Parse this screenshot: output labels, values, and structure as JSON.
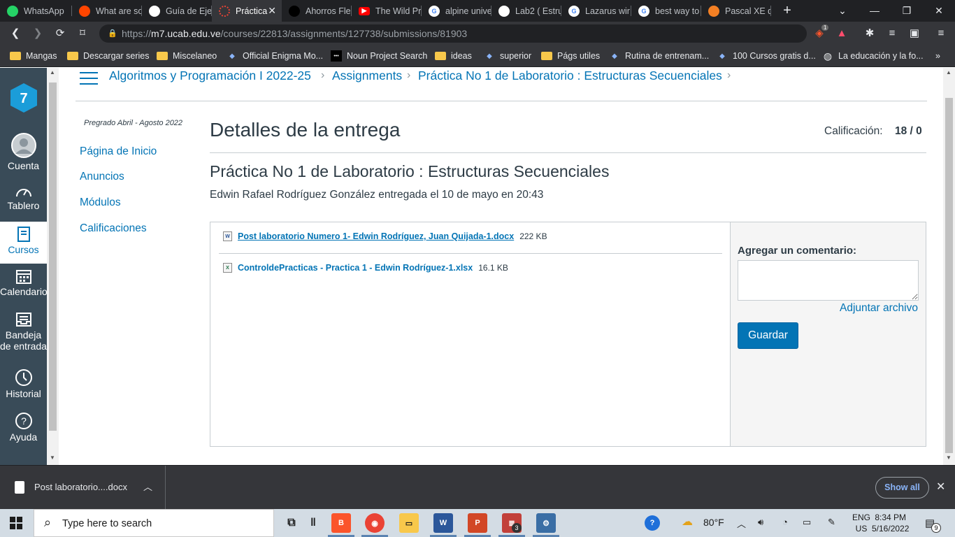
{
  "browser": {
    "tabs": [
      {
        "label": "WhatsApp",
        "icon": "whatsapp-icon",
        "color": "#25d366",
        "active": false
      },
      {
        "label": "What are so",
        "icon": "reddit-icon",
        "color": "#ff4500",
        "active": false
      },
      {
        "label": "Guía de Ejer",
        "icon": "globe-icon",
        "color": "#ffffff",
        "active": false
      },
      {
        "label": "Práctica",
        "icon": "loading-icon",
        "color": "#ea4335",
        "active": true
      },
      {
        "label": "Ahorros Flex",
        "icon": "site-icon",
        "color": "#000000",
        "active": false
      },
      {
        "label": "The Wild Pr",
        "icon": "youtube-icon",
        "color": "#ff0000",
        "active": false
      },
      {
        "label": "alpine unive",
        "icon": "google-icon",
        "color": "#ffffff",
        "active": false
      },
      {
        "label": "Lab2 ( Estru",
        "icon": "globe-icon",
        "color": "#ffffff",
        "active": false
      },
      {
        "label": "Lazarus wir",
        "icon": "google-icon",
        "color": "#ffffff",
        "active": false
      },
      {
        "label": "best way to",
        "icon": "google-icon",
        "color": "#ffffff",
        "active": false
      },
      {
        "label": "Pascal XE de",
        "icon": "site-icon",
        "color": "#f48024",
        "active": false
      }
    ],
    "url_prefix": "https://",
    "url_host": "m7.ucab.edu.ve",
    "url_path": "/courses/22813/assignments/127738/submissions/81903",
    "brave_badge": "1",
    "bookmarks": [
      {
        "label": "Mangas",
        "icon": "folder-icon"
      },
      {
        "label": "Descargar series",
        "icon": "folder-icon"
      },
      {
        "label": "Miscelaneo",
        "icon": "folder-icon"
      },
      {
        "label": "Official Enigma Mo...",
        "icon": "site-icon"
      },
      {
        "label": "Noun Project Search",
        "icon": "noun-project-icon"
      },
      {
        "label": "ideas",
        "icon": "folder-icon"
      },
      {
        "label": "superior",
        "icon": "site-icon"
      },
      {
        "label": "Págs utiles",
        "icon": "folder-icon"
      },
      {
        "label": "Rutina de entrenam...",
        "icon": "site-icon"
      },
      {
        "label": "100 Cursos gratis d...",
        "icon": "site-icon"
      },
      {
        "label": "La educación y la fo...",
        "icon": "globe-icon"
      }
    ]
  },
  "global_nav": {
    "logo": "m7-logo",
    "items": [
      {
        "label": "Cuenta",
        "icon": "account-icon"
      },
      {
        "label": "Tablero",
        "icon": "dashboard-icon"
      },
      {
        "label": "Cursos",
        "icon": "courses-icon"
      },
      {
        "label": "Calendario",
        "icon": "calendar-icon"
      },
      {
        "label": "Bandeja",
        "label2": "de entrada",
        "icon": "inbox-icon"
      },
      {
        "label": "Historial",
        "icon": "history-icon"
      },
      {
        "label": "Ayuda",
        "icon": "help-icon"
      }
    ]
  },
  "breadcrumb": {
    "course": "Algoritmos y Programación I 2022-25",
    "section": "Assignments",
    "assignment": "Práctica No 1 de Laboratorio : Estructuras Secuenciales"
  },
  "course_nav": {
    "term": "Pregrado Abril - Agosto 2022",
    "items": [
      "Página de Inicio",
      "Anuncios",
      "Módulos",
      "Calificaciones"
    ]
  },
  "submission": {
    "page_title": "Detalles de la entrega",
    "grade_label": "Calificación:",
    "grade_value": "18 / 0",
    "assignment_title": "Práctica No 1 de Laboratorio : Estructuras Secuenciales",
    "submitted_line": "Edwin Rafael Rodríguez González entregada el 10 de mayo en 20:43",
    "files": [
      {
        "name": "Post laboratorio Numero 1- Edwin Rodríguez, Juan Quijada-1.docx",
        "size": "222 KB",
        "icon": "word-file-icon"
      },
      {
        "name": "ControldePracticas - Practica 1 - Edwin Rodríguez-1.xlsx",
        "size": "16.1 KB",
        "icon": "excel-file-icon"
      }
    ],
    "comment_label": "Agregar un comentario:",
    "comment_value": "",
    "attach_label": "Adjuntar archivo",
    "save_label": "Guardar"
  },
  "downloads": {
    "item": "Post laboratorio....docx",
    "show_all": "Show all"
  },
  "taskbar": {
    "search_placeholder": "Type here to search",
    "weather": "80°F",
    "lang1": "ENG",
    "lang2": "US",
    "time": "8:34 PM",
    "date": "5/16/2022",
    "notif_count": "9",
    "app_badge": "3"
  },
  "colors": {
    "accent": "#0374b5",
    "nav_bg": "#394b58",
    "text": "#2d3b45"
  }
}
